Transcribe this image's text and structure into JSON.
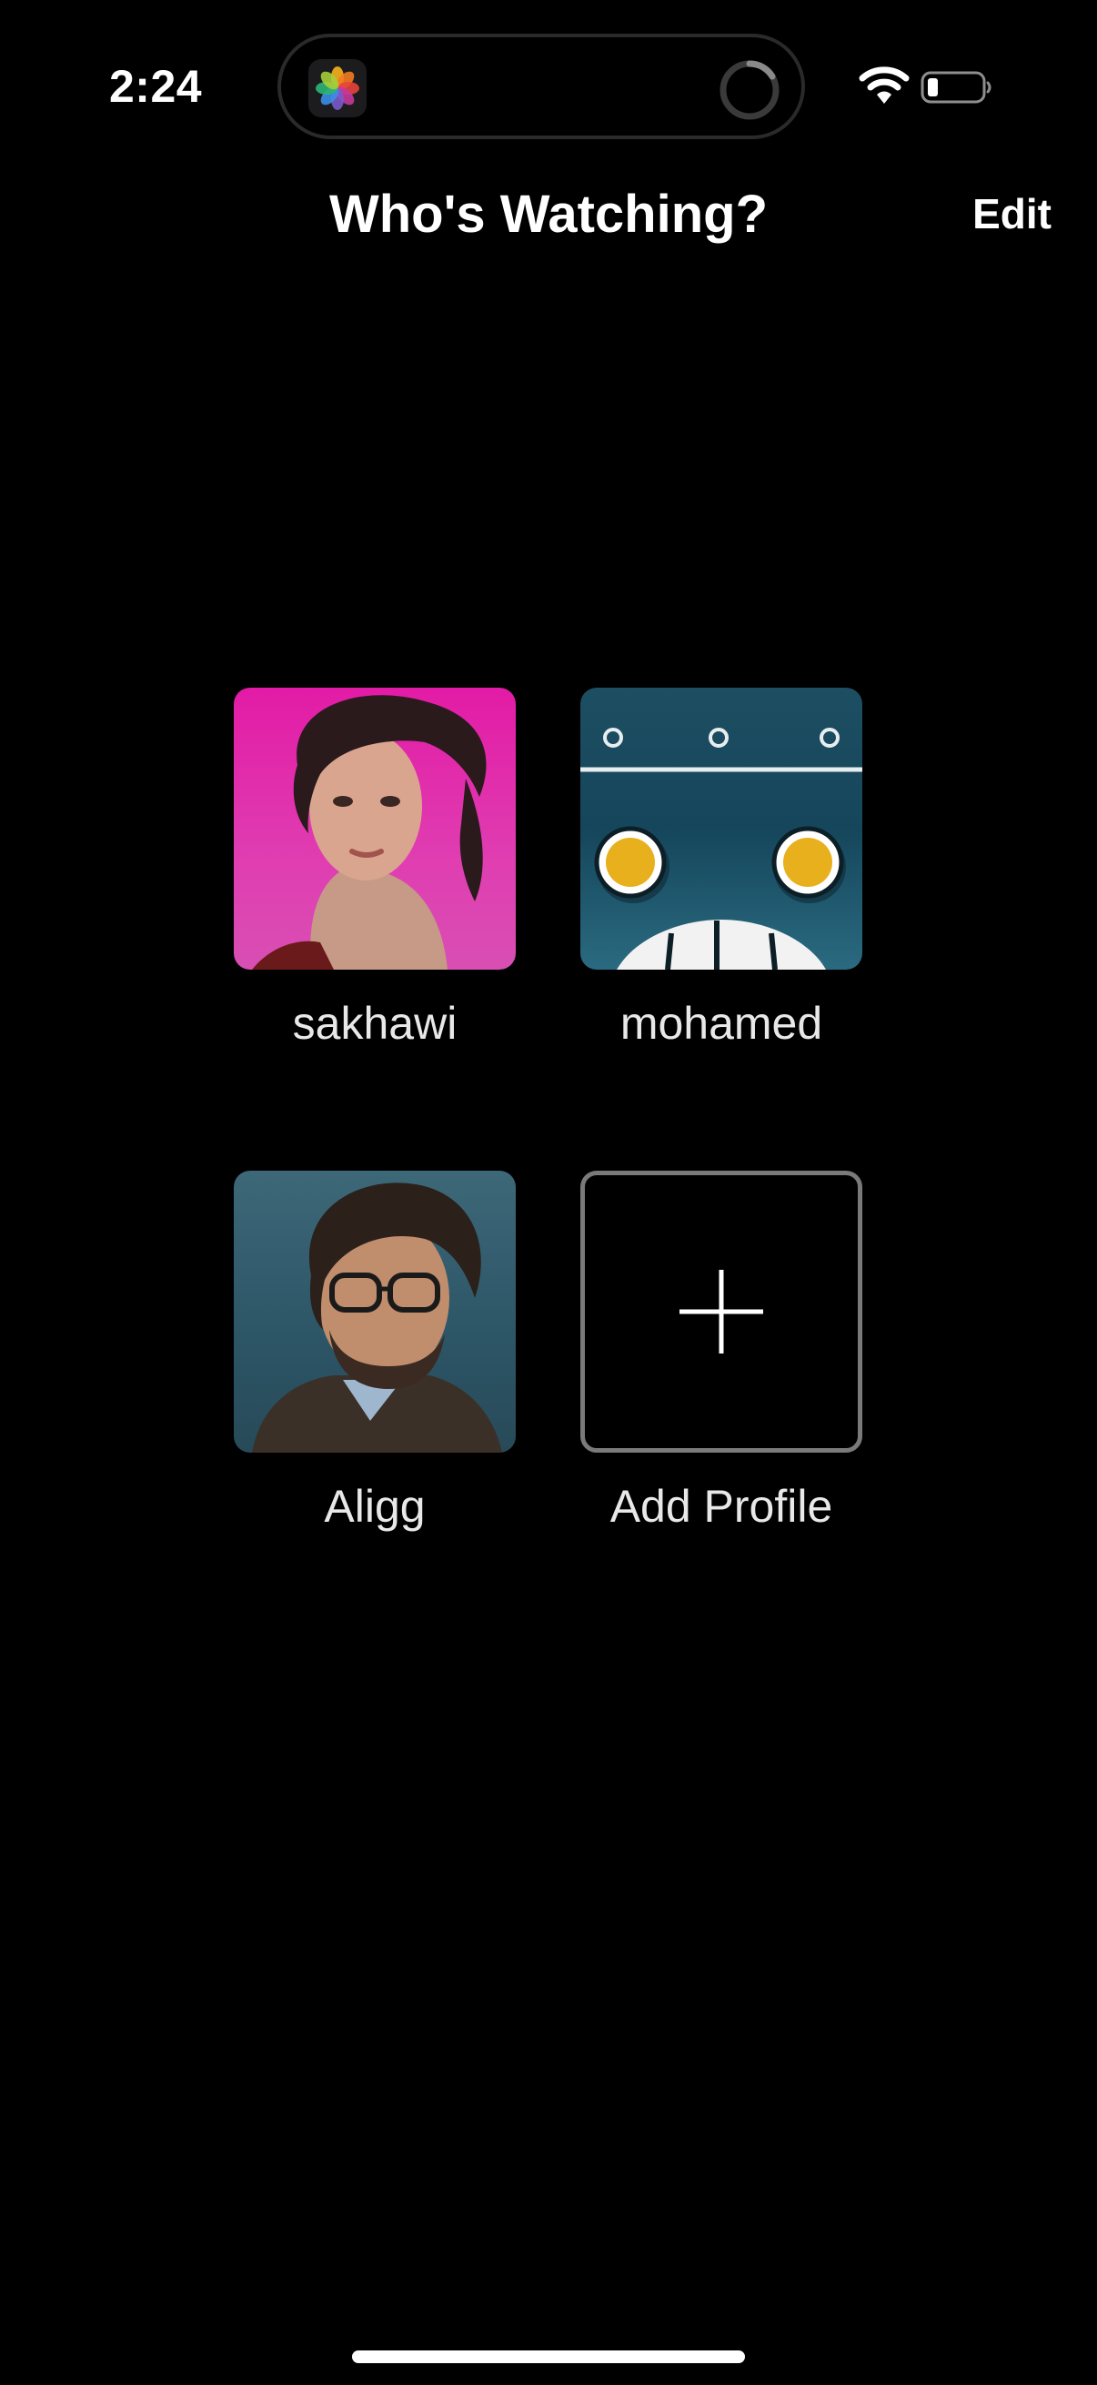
{
  "status_bar": {
    "time": "2:24",
    "wifi_icon": "wifi-icon",
    "battery_icon": "battery-low-icon",
    "island_app_icon": "photos-app-icon"
  },
  "header": {
    "title": "Who's Watching?",
    "edit_label": "Edit"
  },
  "profiles": [
    {
      "name": "sakhawi",
      "avatar": "portrait-short-hair-pink-background"
    },
    {
      "name": "mohamed",
      "avatar": "robot-face-teal"
    },
    {
      "name": "Aligg",
      "avatar": "portrait-man-glasses-beard"
    }
  ],
  "add_profile": {
    "label": "Add Profile",
    "icon": "plus-icon"
  },
  "colors": {
    "background": "#000000",
    "text": "#ffffff",
    "add_border": "#7a7a7a"
  }
}
